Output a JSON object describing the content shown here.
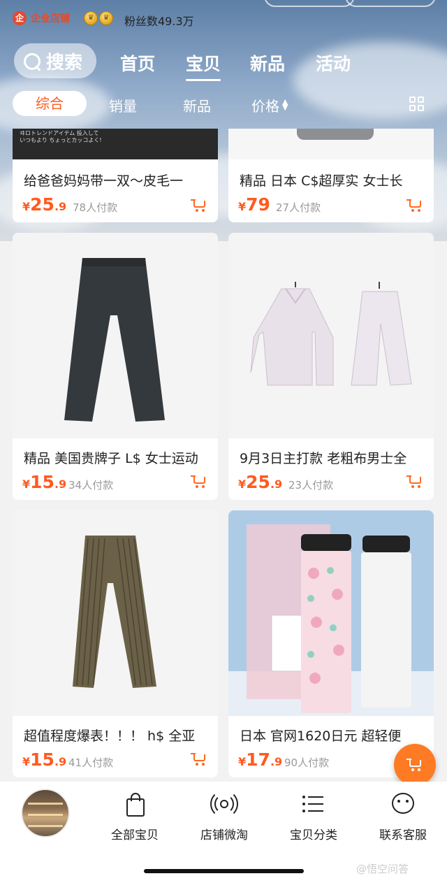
{
  "header": {
    "shop_badge": "企业店铺",
    "fans": "粉丝数49.3万"
  },
  "nav": {
    "search": "搜索",
    "tabs": [
      "首页",
      "宝贝",
      "新品",
      "活动"
    ],
    "active_tab": "宝贝"
  },
  "sort": {
    "items": [
      "综合",
      "销量",
      "新品",
      "价格"
    ],
    "active": "综合"
  },
  "products": [
    {
      "title": "给爸爸妈妈带一双～皮毛一",
      "price_int": "25",
      "price_dec": ".9",
      "sold": "78人付款"
    },
    {
      "title": "精品 日本 C$超厚实 女士长",
      "price_int": "79",
      "price_dec": "",
      "sold": "27人付款"
    },
    {
      "title": "精品 美国贵牌子 L$ 女士运动",
      "price_int": "15",
      "price_dec": ".9",
      "sold": "34人付款"
    },
    {
      "title": "9月3日主打款 老粗布男士全",
      "price_int": "25",
      "price_dec": ".9",
      "sold": "23人付款"
    },
    {
      "title": "超值程度爆表！！！ h$ 全亚",
      "price_int": "15",
      "price_dec": ".9",
      "sold": "41人付款"
    },
    {
      "title": "日本 官网1620日元 超轻便",
      "price_int": "17",
      "price_dec": ".9",
      "sold": "90人付款"
    }
  ],
  "currency": "¥",
  "first_card_banner": "ヰロトレンドアイテム 投入していつもより ちょっとカッコよく!",
  "bottom": {
    "items": [
      "全部宝贝",
      "店铺微淘",
      "宝贝分类",
      "联系客服"
    ]
  },
  "watermark": "@悟空问答",
  "colors": {
    "accent": "#ff5a1f",
    "shop_red": "#e24a2f"
  }
}
